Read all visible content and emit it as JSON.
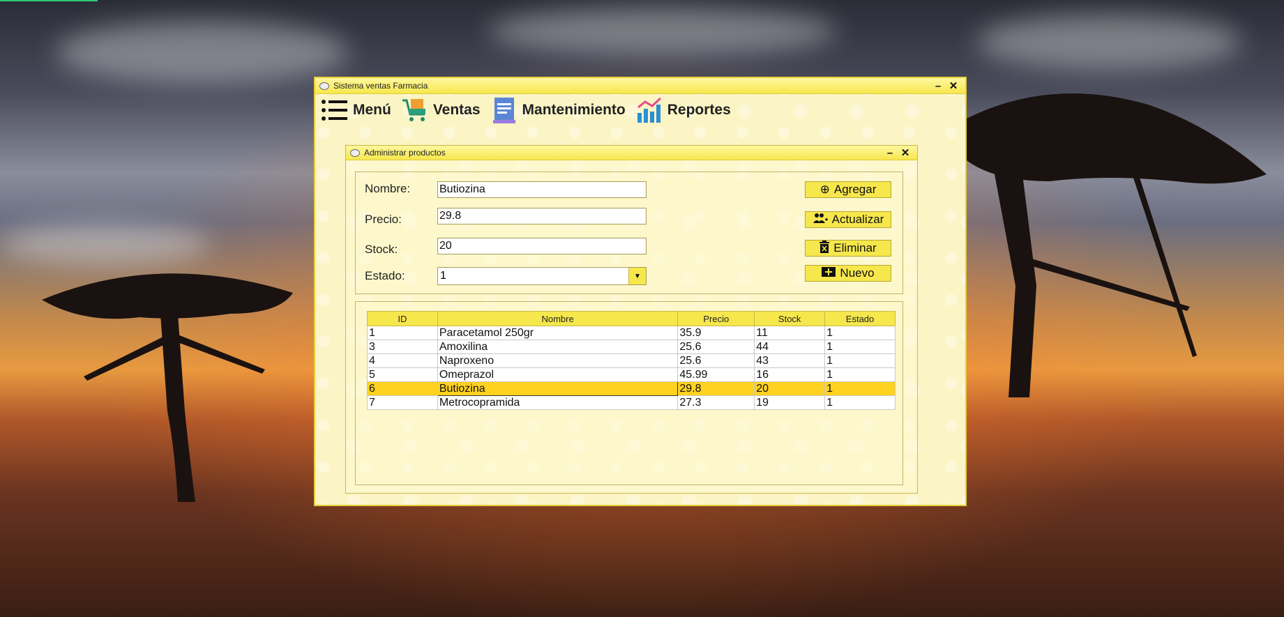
{
  "main_window": {
    "title": "Sistema ventas Farmacia",
    "minimize": "–",
    "close": "✕"
  },
  "menu": [
    {
      "label": "Menú",
      "icon": "hamburger-icon"
    },
    {
      "label": "Ventas",
      "icon": "cart-icon"
    },
    {
      "label": "Mantenimiento",
      "icon": "document-icon"
    },
    {
      "label": "Reportes",
      "icon": "chart-icon"
    }
  ],
  "products_window": {
    "title": "Administrar productos",
    "minimize": "–",
    "close": "✕"
  },
  "form": {
    "nombre_label": "Nombre:",
    "nombre_value": "Butiozina",
    "precio_label": "Precio:",
    "precio_value": "29.8",
    "stock_label": "Stock:",
    "stock_value": "20",
    "estado_label": "Estado:",
    "estado_value": "1"
  },
  "buttons": {
    "agregar": "Agregar",
    "actualizar": "Actualizar",
    "eliminar": "Eliminar",
    "nuevo": "Nuevo"
  },
  "table": {
    "headers": [
      "ID",
      "Nombre",
      "Precio",
      "Stock",
      "Estado"
    ],
    "rows": [
      [
        "1",
        "Paracetamol 250gr",
        "35.9",
        "11",
        "1"
      ],
      [
        "3",
        "Amoxilina",
        "25.6",
        "44",
        "1"
      ],
      [
        "4",
        "Naproxeno",
        "25.6",
        "43",
        "1"
      ],
      [
        "5",
        "Omeprazol",
        "45.99",
        "16",
        "1"
      ],
      [
        "6",
        "Butiozina",
        "29.8",
        "20",
        "1"
      ],
      [
        "7",
        "Metrocopramida",
        "27.3",
        "19",
        "1"
      ]
    ],
    "selected_row": 4
  },
  "colors": {
    "window_bg": "#fbf4c4",
    "accent_yellow": "#f6e74d",
    "selected_row": "#ffd21f"
  }
}
